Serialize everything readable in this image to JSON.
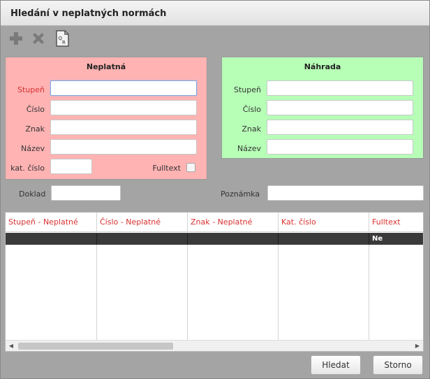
{
  "window": {
    "title": "Hledání v neplatných normách"
  },
  "toolbar": {
    "icons": [
      "add-icon",
      "delete-icon",
      "qr-document-icon"
    ]
  },
  "panel_neplatna": {
    "title": "Neplatná",
    "stupen_label": "Stupeň",
    "cislo_label": "Číslo",
    "znak_label": "Znak",
    "nazev_label": "Název",
    "kat_cislo_label": "kat. číslo",
    "fulltext_label": "Fulltext",
    "color": "#ffb3b3"
  },
  "panel_nahrada": {
    "title": "Náhrada",
    "stupen_label": "Stupeň",
    "cislo_label": "Číslo",
    "znak_label": "Znak",
    "nazev_label": "Název",
    "color": "#b7ffb7"
  },
  "doklad_label": "Doklad",
  "poznamka_label": "Poznámka",
  "grid": {
    "columns": [
      "Stupeň - Neplatné",
      "Číslo - Neplatné",
      "Znak - Neplatné",
      "Kat. číslo",
      "Fulltext"
    ],
    "rows": [
      [
        "",
        "",
        "",
        "",
        "Ne"
      ]
    ]
  },
  "buttons": {
    "search": "Hledat",
    "cancel": "Storno"
  }
}
